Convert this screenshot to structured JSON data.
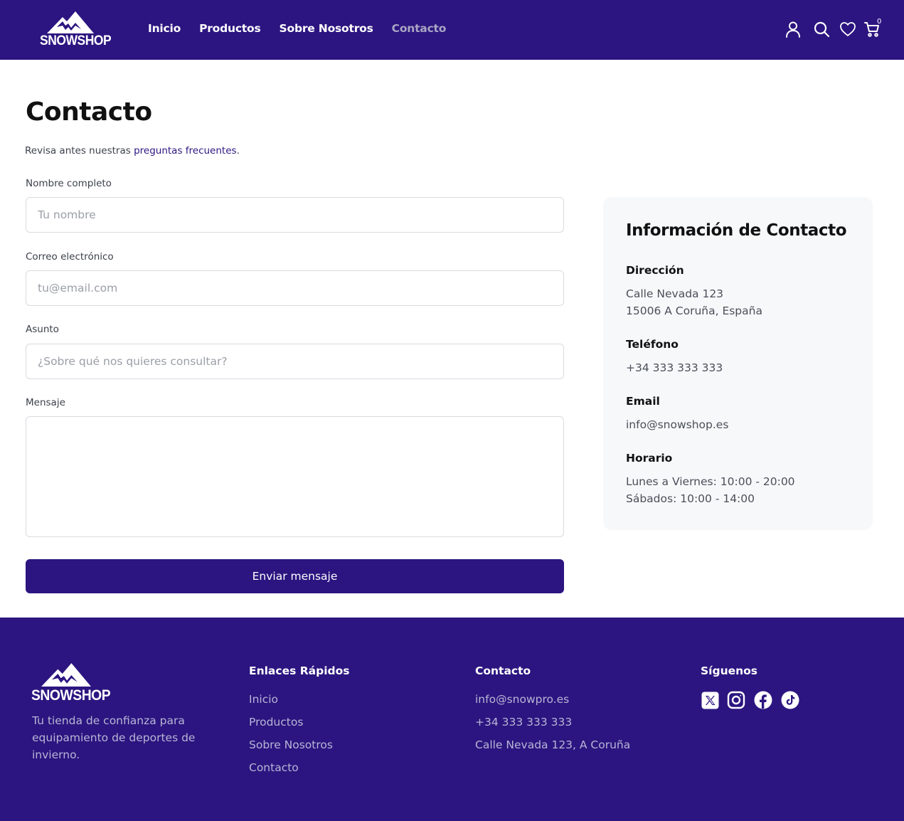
{
  "brand": {
    "name": "SNOWSHOP"
  },
  "nav": {
    "items": [
      {
        "label": "Inicio"
      },
      {
        "label": "Productos"
      },
      {
        "label": "Sobre Nosotros"
      },
      {
        "label": "Contacto",
        "active": true
      }
    ]
  },
  "header_icons": [
    "user-icon",
    "search-icon",
    "heart-icon",
    "cart-icon"
  ],
  "cart": {
    "count": "0"
  },
  "page": {
    "title": "Contacto",
    "intro_prefix": "Revisa antes nuestras ",
    "intro_link": "preguntas frecuentes",
    "intro_suffix": "."
  },
  "form": {
    "name": {
      "label": "Nombre completo",
      "placeholder": "Tu nombre",
      "value": ""
    },
    "email": {
      "label": "Correo electrónico",
      "placeholder": "tu@email.com",
      "value": ""
    },
    "subject": {
      "label": "Asunto",
      "placeholder": "¿Sobre qué nos quieres consultar?",
      "value": ""
    },
    "message": {
      "label": "Mensaje",
      "placeholder": "",
      "value": ""
    },
    "submit_label": "Enviar mensaje"
  },
  "info": {
    "title": "Información de Contacto",
    "address": {
      "label": "Dirección",
      "line1": "Calle Nevada 123",
      "line2": "15006 A Coruña, España"
    },
    "phone": {
      "label": "Teléfono",
      "value": "+34 333 333 333"
    },
    "email": {
      "label": "Email",
      "value": "info@snowshop.es"
    },
    "hours": {
      "label": "Horario",
      "line1": "Lunes a Viernes: 10:00 - 20:00",
      "line2": "Sábados: 10:00 - 14:00"
    }
  },
  "footer": {
    "tagline": "Tu tienda de confianza para equipamiento de deportes de invierno.",
    "quick_links": {
      "title": "Enlaces Rápidos",
      "items": [
        {
          "label": "Inicio"
        },
        {
          "label": "Productos"
        },
        {
          "label": "Sobre Nosotros"
        },
        {
          "label": "Contacto"
        }
      ]
    },
    "contact": {
      "title": "Contacto",
      "email": "info@snowpro.es",
      "phone": "+34 333 333 333",
      "address": "Calle Nevada 123, A Coruña"
    },
    "social": {
      "title": "Síguenos",
      "icons": [
        "x-icon",
        "instagram-icon",
        "facebook-icon",
        "tiktok-icon"
      ]
    }
  },
  "colors": {
    "primary": "#2c1580",
    "nav_active": "#aaa6c4",
    "footer_text": "#b9b5d6",
    "card_bg": "#f7f8fa",
    "input_border": "#d8dbe0"
  }
}
